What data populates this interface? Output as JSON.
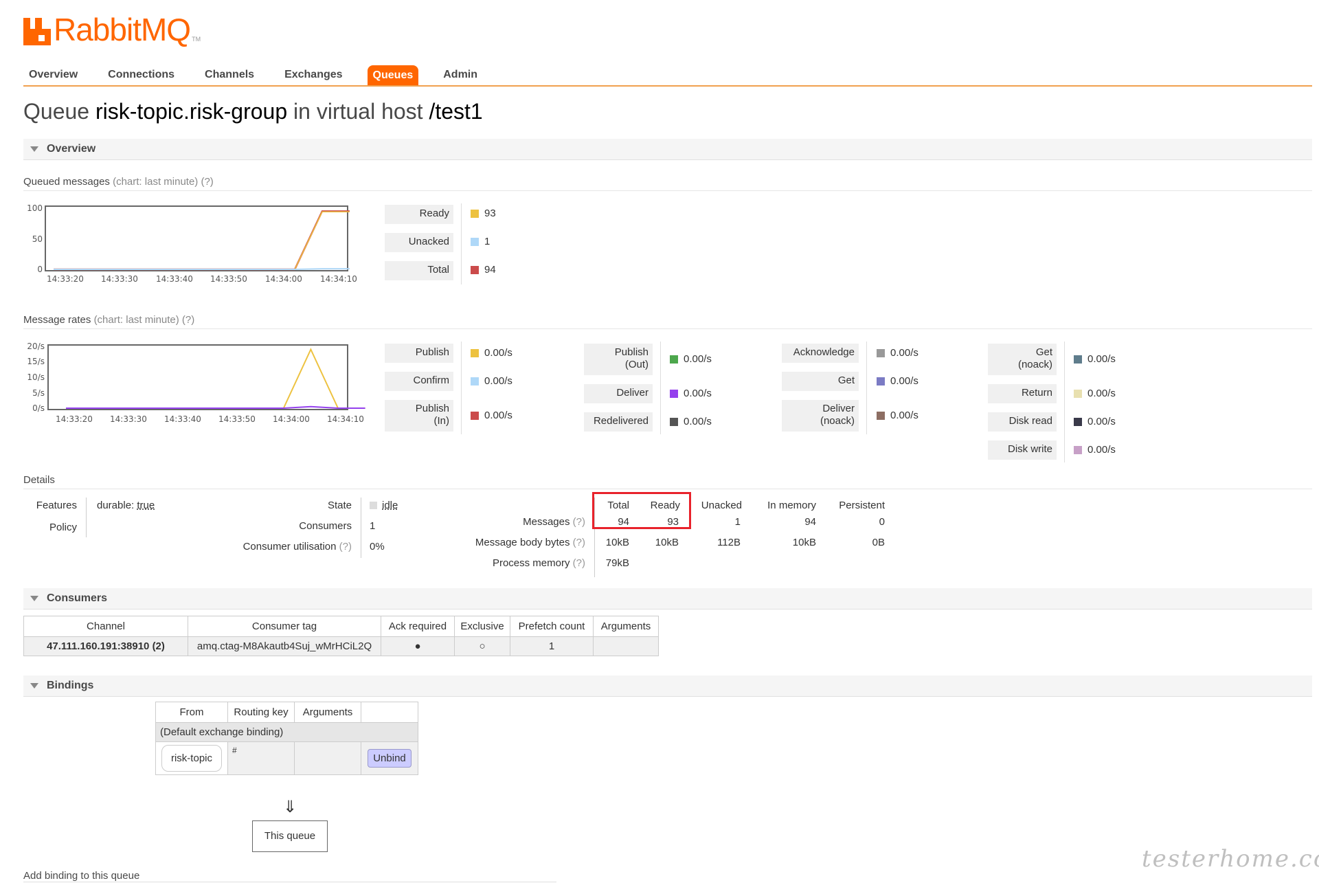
{
  "brand": {
    "name": "RabbitMQ",
    "tm": "TM"
  },
  "nav": {
    "tabs": [
      "Overview",
      "Connections",
      "Channels",
      "Exchanges",
      "Queues",
      "Admin"
    ],
    "active": "Queues"
  },
  "title": {
    "prefix": "Queue",
    "queue": "risk-topic.risk-group",
    "middle": "in virtual host",
    "vhost": "/test1"
  },
  "sections": {
    "overview": "Overview",
    "consumers": "Consumers",
    "bindings": "Bindings"
  },
  "queued": {
    "heading": "Queued messages",
    "note": "(chart: last minute) (?)",
    "yticks": [
      "100",
      "50",
      "0"
    ],
    "xticks": [
      "14:33:20",
      "14:33:30",
      "14:33:40",
      "14:33:50",
      "14:34:00",
      "14:34:10"
    ],
    "legend": [
      {
        "label": "Ready",
        "value": "93",
        "color": "#edc240"
      },
      {
        "label": "Unacked",
        "value": "1",
        "color": "#afd8f8"
      },
      {
        "label": "Total",
        "value": "94",
        "color": "#cb4b4b"
      }
    ]
  },
  "rates": {
    "heading": "Message rates",
    "note": "(chart: last minute) (?)",
    "yticks": [
      "20/s",
      "15/s",
      "10/s",
      "5/s",
      "0/s"
    ],
    "xticks": [
      "14:33:20",
      "14:33:30",
      "14:33:40",
      "14:33:50",
      "14:34:00",
      "14:34:10"
    ],
    "col1": [
      {
        "label": "Publish",
        "value": "0.00/s",
        "color": "#edc240"
      },
      {
        "label": "Confirm",
        "value": "0.00/s",
        "color": "#afd8f8"
      },
      {
        "label": "Publish (In)",
        "l1": "Publish",
        "l2": "(In)",
        "value": "0.00/s",
        "color": "#cb4b4b"
      }
    ],
    "col2": [
      {
        "label": "Publish (Out)",
        "l1": "Publish",
        "l2": "(Out)",
        "value": "0.00/s",
        "color": "#4da74d"
      },
      {
        "label": "Deliver",
        "value": "0.00/s",
        "color": "#9440ed"
      },
      {
        "label": "Redelivered",
        "value": "0.00/s",
        "color": "#555555"
      }
    ],
    "col3": [
      {
        "label": "Acknowledge",
        "value": "0.00/s",
        "color": "#999999"
      },
      {
        "label": "Get",
        "value": "0.00/s",
        "color": "#7b7bc4"
      },
      {
        "label": "Deliver (noack)",
        "l1": "Deliver",
        "l2": "(noack)",
        "value": "0.00/s",
        "color": "#8d6e63"
      }
    ],
    "col4": [
      {
        "label": "Get (noack)",
        "l1": "Get",
        "l2": "(noack)",
        "value": "0.00/s",
        "color": "#5f7d8c"
      },
      {
        "label": "Return",
        "value": "0.00/s",
        "color": "#e8e0b0"
      },
      {
        "label": "Disk read",
        "value": "0.00/s",
        "color": "#3a3a4a"
      },
      {
        "label": "Disk write",
        "value": "0.00/s",
        "color": "#c7a0c7"
      }
    ]
  },
  "details": {
    "heading": "Details",
    "features_label": "Features",
    "features_key": "durable:",
    "features_value": "true",
    "policy_label": "Policy",
    "state_label": "State",
    "state_value": "idle",
    "consumers_label": "Consumers",
    "consumers_value": "1",
    "util_label": "Consumer utilisation",
    "util_q": "(?)",
    "util_value": "0%",
    "cols": [
      "Total",
      "Ready",
      "Unacked",
      "In memory",
      "Persistent"
    ],
    "rows": [
      {
        "label": "Messages",
        "q": "(?)",
        "values": [
          "94",
          "93",
          "1",
          "94",
          "0"
        ]
      },
      {
        "label": "Message body bytes",
        "q": "(?)",
        "values": [
          "10kB",
          "10kB",
          "112B",
          "10kB",
          "0B"
        ]
      },
      {
        "label": "Process memory",
        "q": "(?)",
        "values": [
          "79kB"
        ]
      }
    ]
  },
  "consumers": {
    "headers": [
      "Channel",
      "Consumer tag",
      "Ack required",
      "Exclusive",
      "Prefetch count",
      "Arguments"
    ],
    "rows": [
      {
        "channel": "47.111.160.191:38910 (2)",
        "tag": "amq.ctag-M8Akautb4Suj_wMrHCiL2Q",
        "ack": "●",
        "exclusive": "○",
        "prefetch": "1",
        "args": ""
      }
    ]
  },
  "bindings": {
    "headers": [
      "From",
      "Routing key",
      "Arguments",
      ""
    ],
    "default_row": "(Default exchange binding)",
    "rows": [
      {
        "from": "risk-topic",
        "routing_key": "#",
        "args": "",
        "action": "Unbind"
      }
    ],
    "arrow": "⇓",
    "target": "This queue"
  },
  "add_binding": "Add binding to this queue",
  "watermark": "testerhome.com",
  "chart_data": [
    {
      "type": "line",
      "title": "Queued messages",
      "x": [
        "14:33:20",
        "14:33:30",
        "14:33:40",
        "14:33:50",
        "14:34:00",
        "14:34:10",
        "14:34:15"
      ],
      "series": [
        {
          "name": "Ready",
          "values": [
            0,
            0,
            0,
            0,
            0,
            93,
            93
          ]
        },
        {
          "name": "Unacked",
          "values": [
            0,
            0,
            0,
            0,
            0,
            1,
            1
          ]
        },
        {
          "name": "Total",
          "values": [
            0,
            0,
            0,
            0,
            0,
            94,
            94
          ]
        }
      ],
      "ylim": [
        0,
        100
      ]
    },
    {
      "type": "line",
      "title": "Message rates",
      "x": [
        "14:33:20",
        "14:33:30",
        "14:33:40",
        "14:33:50",
        "14:34:00",
        "14:34:05",
        "14:34:10",
        "14:34:15"
      ],
      "series": [
        {
          "name": "Publish",
          "values": [
            0,
            0,
            0,
            0,
            0,
            19,
            0,
            0
          ]
        },
        {
          "name": "Deliver",
          "values": [
            0,
            0,
            0,
            0,
            0,
            0.5,
            0,
            0
          ]
        }
      ],
      "ylim": [
        0,
        20
      ]
    }
  ]
}
